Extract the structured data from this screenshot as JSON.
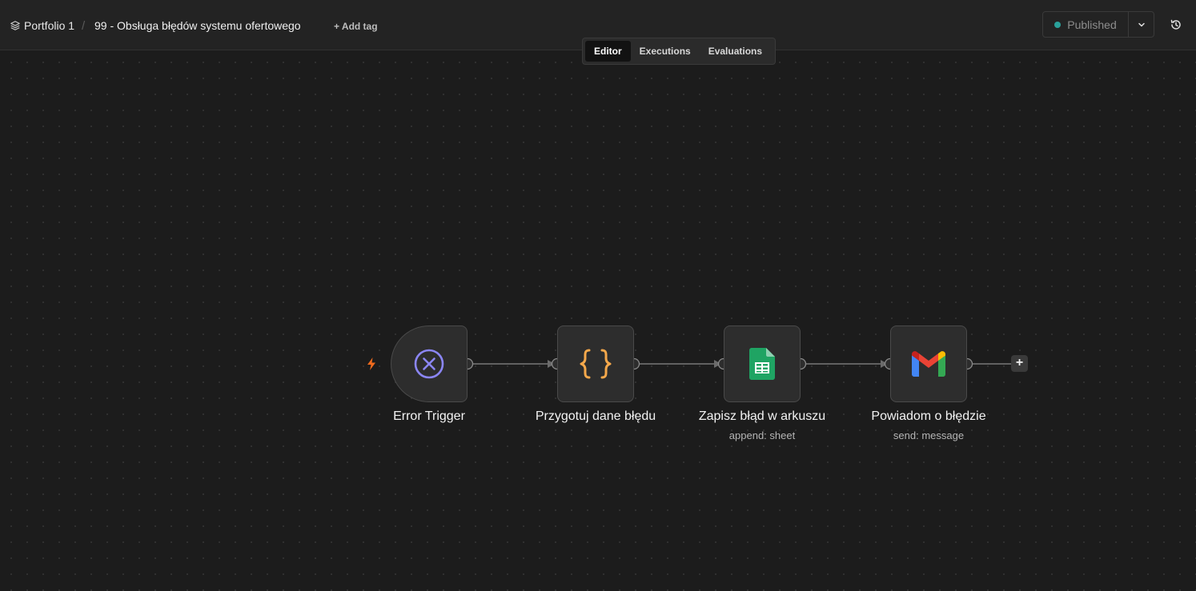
{
  "header": {
    "project_name": "Portfolio 1",
    "separator": "/",
    "workflow_name": "99 - Obsługa błędów systemu ofertowego",
    "add_tag_label": "+ Add tag",
    "publish_label": "Published",
    "status_color": "#2aa19b"
  },
  "tabs": [
    {
      "label": "Editor",
      "active": true
    },
    {
      "label": "Executions",
      "active": false
    },
    {
      "label": "Evaluations",
      "active": false
    }
  ],
  "nodes": [
    {
      "label": "Error Trigger",
      "subtitle": "",
      "icon": "error-trigger-icon"
    },
    {
      "label": "Przygotuj dane błędu",
      "subtitle": "",
      "icon": "code-braces-icon"
    },
    {
      "label": "Zapisz błąd w arkuszu",
      "subtitle": "append: sheet",
      "icon": "google-sheets-icon"
    },
    {
      "label": "Powiadom o błędzie",
      "subtitle": "send: message",
      "icon": "gmail-icon"
    }
  ],
  "add_node_label": "+",
  "colors": {
    "trigger_icon": "#8b86f6",
    "code_icon": "#f5a84b",
    "sheets_green": "#1fa463",
    "bolt": "#f26b1d"
  }
}
